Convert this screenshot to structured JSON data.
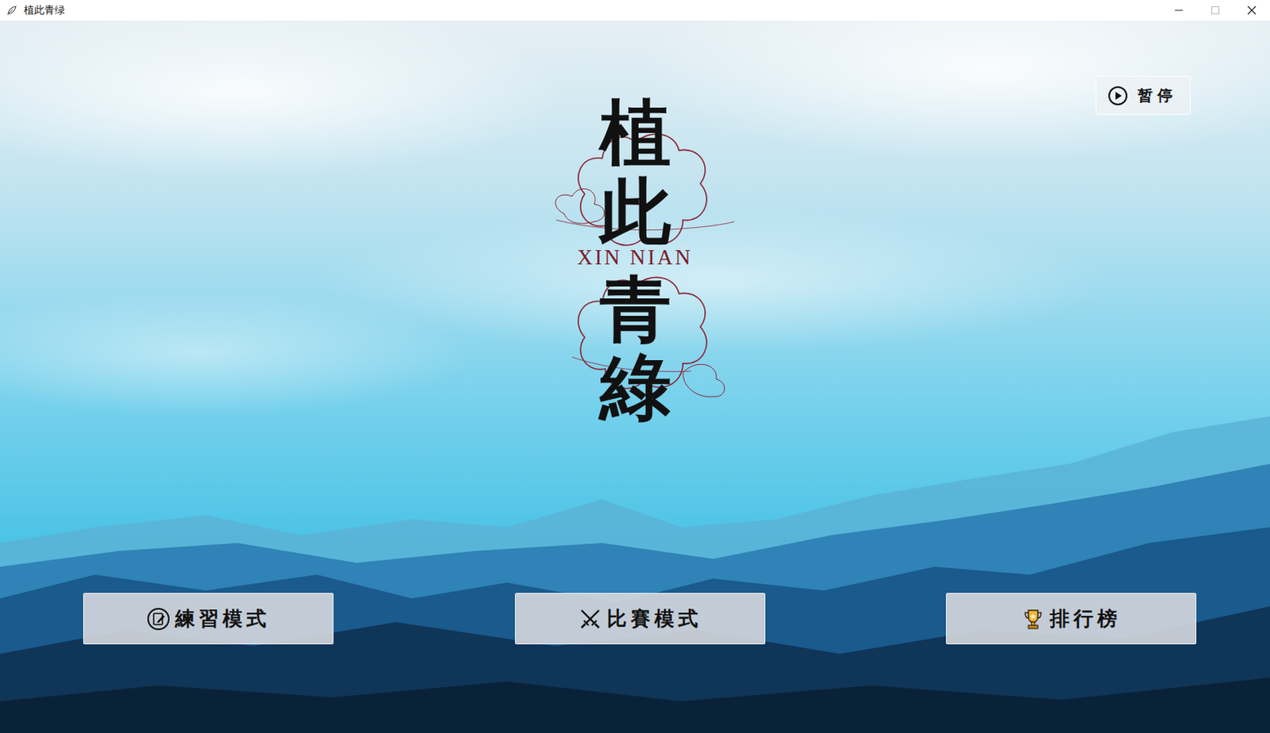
{
  "window": {
    "title": "植此青绿",
    "controls": [
      {
        "kind": "minimize",
        "disabled": false
      },
      {
        "kind": "maximize",
        "disabled": true
      },
      {
        "kind": "close",
        "disabled": false
      }
    ]
  },
  "logo": {
    "top": "植此",
    "subtitle": "XIN NIAN",
    "bottom": "青綠"
  },
  "pause_button": {
    "label": "暂停"
  },
  "menu_buttons": [
    {
      "label": "練習模式",
      "kind": "practice"
    },
    {
      "label": "比賽模式",
      "kind": "match"
    },
    {
      "label": "排行榜",
      "kind": "leaderboard"
    }
  ]
}
